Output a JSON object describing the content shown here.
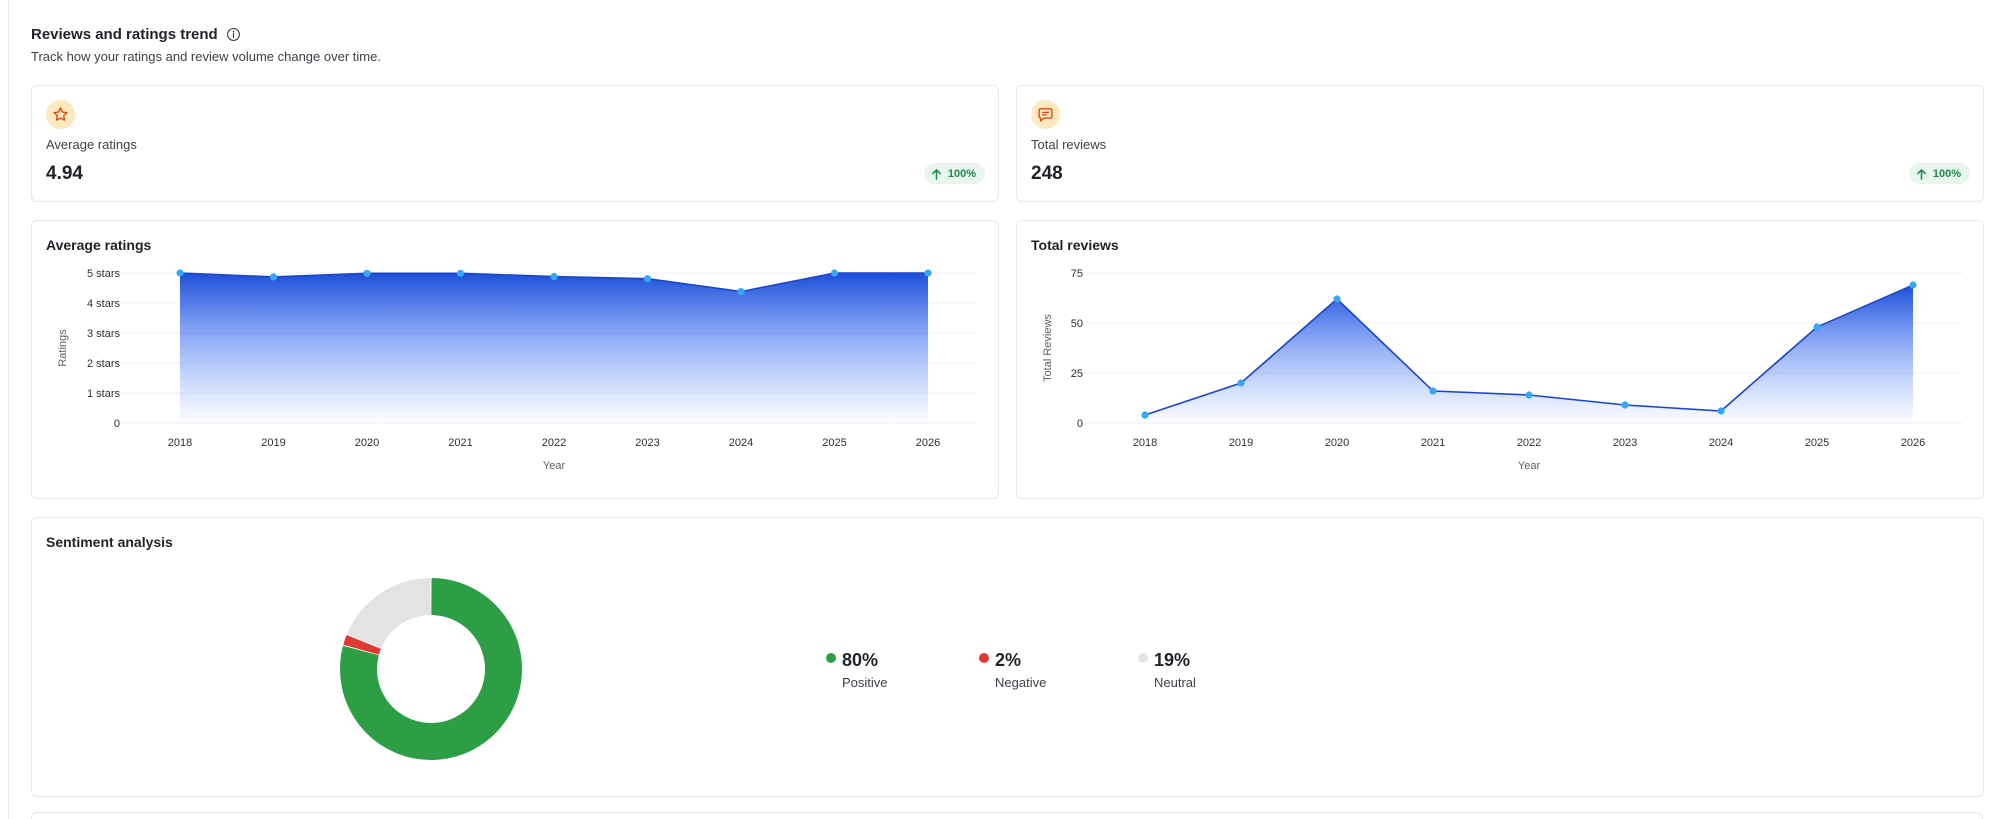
{
  "header": {
    "title": "Reviews and ratings trend",
    "subtitle": "Track how your ratings and review volume change over time."
  },
  "stats": [
    {
      "label": "Average ratings",
      "value": "4.94",
      "change": "100%",
      "icon": "star-icon"
    },
    {
      "label": "Total reviews",
      "value": "248",
      "change": "100%",
      "icon": "chat-bubble-icon"
    }
  ],
  "colors": {
    "accent_blue": "#1d4ed8",
    "point_blue": "#38a8f5",
    "positive": "#2e9e46",
    "negative": "#dc3a32",
    "neutral": "#e3e3e3",
    "badge_green": "#1e8a4c",
    "icon_bg": "#fde9c0"
  },
  "chart_data": [
    {
      "type": "area",
      "title": "Average ratings",
      "xlabel": "Year",
      "ylabel": "Ratings",
      "x": [
        "2018",
        "2019",
        "2020",
        "2021",
        "2022",
        "2023",
        "2024",
        "2025",
        "2026"
      ],
      "values": [
        5.0,
        4.87,
        4.99,
        4.99,
        4.88,
        4.81,
        4.38,
        5.0,
        5.0
      ],
      "ylim": [
        0,
        5
      ],
      "yticks": [
        0,
        1,
        2,
        3,
        4,
        5
      ],
      "ytick_labels": [
        "0",
        "1 stars",
        "2 stars",
        "3 stars",
        "4 stars",
        "5 stars"
      ],
      "grid": true
    },
    {
      "type": "area",
      "title": "Total reviews",
      "xlabel": "Year",
      "ylabel": "Total Reviews",
      "x": [
        "2018",
        "2019",
        "2020",
        "2021",
        "2022",
        "2023",
        "2024",
        "2025",
        "2026"
      ],
      "values": [
        4,
        20,
        62,
        16,
        14,
        9,
        6,
        48,
        69
      ],
      "ylim": [
        0,
        75
      ],
      "yticks": [
        0,
        25,
        50,
        75
      ],
      "ytick_labels": [
        "0",
        "25",
        "50",
        "75"
      ],
      "grid": true
    },
    {
      "type": "pie",
      "title": "Sentiment analysis",
      "categories": [
        "Positive",
        "Negative",
        "Neutral"
      ],
      "values": [
        80,
        2,
        19
      ],
      "labels": [
        "80%",
        "2%",
        "19%"
      ],
      "colors": [
        "#2e9e46",
        "#dc3a32",
        "#e3e3e3"
      ]
    }
  ]
}
